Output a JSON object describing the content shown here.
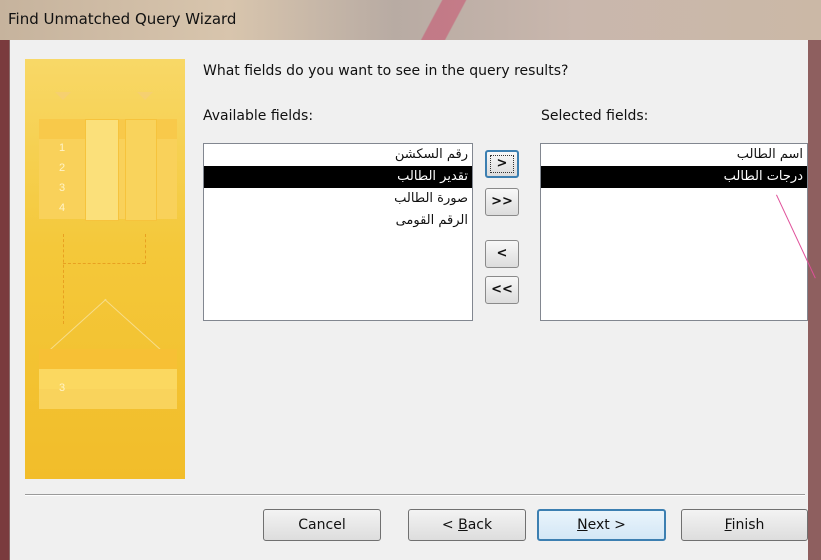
{
  "window": {
    "title": "Find Unmatched Query Wizard"
  },
  "prompt": "What fields do you want to see in the query results?",
  "available": {
    "label": "Available fields:",
    "items": [
      {
        "label": "رقم السكشن",
        "selected": false
      },
      {
        "label": "تقدير الطالب",
        "selected": true
      },
      {
        "label": "صورة الطالب",
        "selected": false
      },
      {
        "label": "الرقم القومى",
        "selected": false
      }
    ]
  },
  "selected_fields": {
    "label": "Selected fields:",
    "items": [
      {
        "label": "اسم الطالب",
        "selected": false
      },
      {
        "label": "درجات الطالب",
        "selected": true
      }
    ]
  },
  "move_buttons": {
    "add_one": ">",
    "add_all": ">>",
    "remove_one": "<",
    "remove_all": "<<"
  },
  "art_numbers": [
    "1",
    "2",
    "3",
    "4",
    "3"
  ],
  "footer": {
    "cancel": "Cancel",
    "back_prefix": "< ",
    "back_hotkey": "B",
    "back_rest": "ack",
    "next_hotkey": "N",
    "next_rest": "ext >",
    "finish_hotkey": "F",
    "finish_rest": "inish"
  },
  "colors": {
    "art_yellow": "#f4c83a",
    "selection": "#000000",
    "focus_blue": "#3c7fb1",
    "annotation_pink": "#e0509a"
  }
}
